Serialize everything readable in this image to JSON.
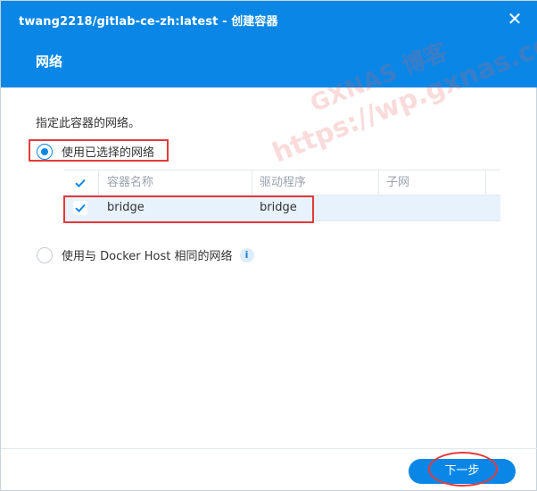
{
  "window": {
    "title": "twang2218/gitlab-ce-zh:latest - 创建容器",
    "close_glyph": "✕"
  },
  "page": {
    "title": "网络",
    "description": "指定此容器的网络。"
  },
  "watermark": {
    "line1": "GXNAS 博客",
    "line2": "https://wp.gxnas.com"
  },
  "network_options": {
    "selected_label": "使用已选择的网络",
    "host_label": "使用与 Docker Host 相同的网络",
    "selected_option": "selected",
    "info_glyph": "i"
  },
  "table": {
    "columns": [
      "容器名称",
      "驱动程序",
      "子网"
    ],
    "rows": [
      {
        "checked": true,
        "name": "bridge",
        "driver": "bridge",
        "subnet": ""
      }
    ]
  },
  "footer": {
    "next_label": "下一步"
  },
  "colors": {
    "accent": "#0a87e6",
    "highlight": "#e43a3a",
    "row_selected": "#e7f2fc"
  }
}
